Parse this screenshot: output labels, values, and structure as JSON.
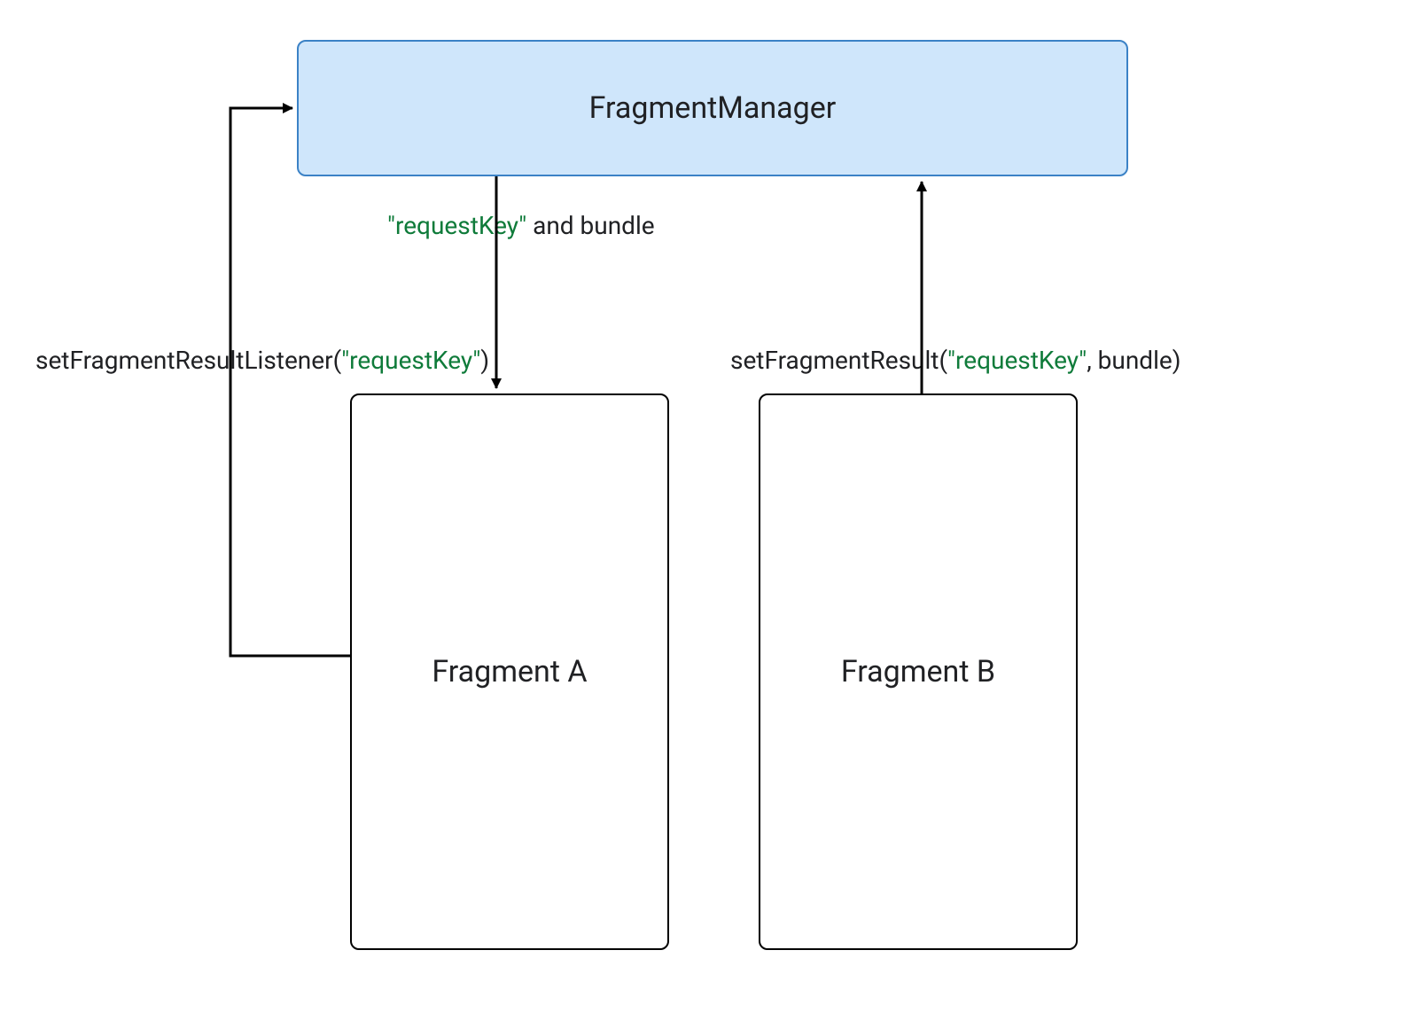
{
  "nodes": {
    "manager": {
      "title": "FragmentManager",
      "fill": "#cfe6fb",
      "stroke": "#3b82c6"
    },
    "fragmentA": {
      "title": "Fragment A"
    },
    "fragmentB": {
      "title": "Fragment B"
    }
  },
  "labels": {
    "listener": {
      "prefix": "setFragmentResultListener(",
      "key": "\"requestKey\"",
      "suffix": ")"
    },
    "bundle": {
      "key": "\"requestKey\"",
      "rest": " and bundle"
    },
    "result": {
      "prefix": "setFragmentResult(",
      "key": "\"requestKey\"",
      "suffix": ", bundle)"
    }
  }
}
